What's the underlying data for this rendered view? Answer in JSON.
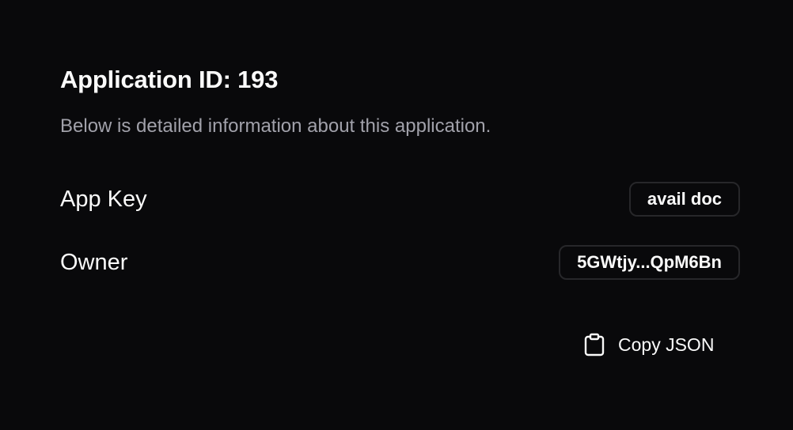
{
  "header": {
    "title": "Application ID: 193",
    "subtitle": "Below is detailed information about this application."
  },
  "details": [
    {
      "label": "App Key",
      "value": "avail doc"
    },
    {
      "label": "Owner",
      "value": "5GWtjy...QpM6Bn"
    }
  ],
  "actions": {
    "copy_label": "Copy JSON",
    "copy_icon": "clipboard-icon"
  },
  "colors": {
    "background": "#09090b",
    "text": "#fafafa",
    "muted": "#a1a1aa",
    "border": "#27272a"
  }
}
